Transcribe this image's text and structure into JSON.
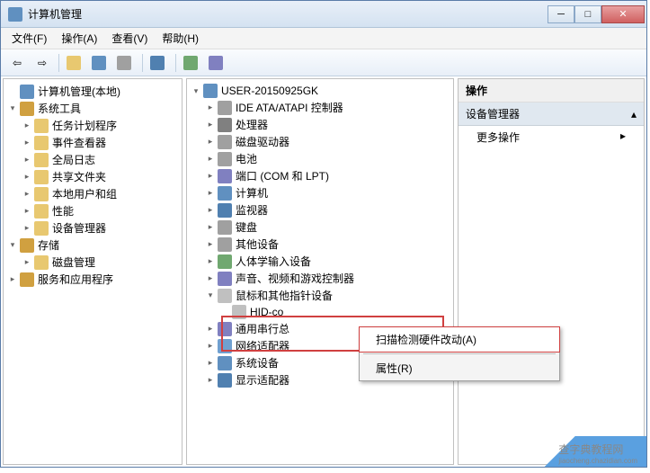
{
  "window": {
    "title": "计算机管理"
  },
  "menubar": [
    "文件(F)",
    "操作(A)",
    "查看(V)",
    "帮助(H)"
  ],
  "left_tree": {
    "root": "计算机管理(本地)",
    "groups": [
      {
        "label": "系统工具",
        "expanded": true,
        "children": [
          "任务计划程序",
          "事件查看器",
          "全局日志",
          "共享文件夹",
          "本地用户和组",
          "性能",
          "设备管理器"
        ]
      },
      {
        "label": "存储",
        "expanded": true,
        "children": [
          "磁盘管理"
        ]
      },
      {
        "label": "服务和应用程序",
        "expanded": false,
        "children": []
      }
    ]
  },
  "mid_tree": {
    "root": "USER-20150925GK",
    "items": [
      {
        "label": "IDE ATA/ATAPI 控制器",
        "ex": false
      },
      {
        "label": "处理器",
        "ex": false
      },
      {
        "label": "磁盘驱动器",
        "ex": false
      },
      {
        "label": "电池",
        "ex": false
      },
      {
        "label": "端口 (COM 和 LPT)",
        "ex": false
      },
      {
        "label": "计算机",
        "ex": false
      },
      {
        "label": "监视器",
        "ex": false
      },
      {
        "label": "键盘",
        "ex": false
      },
      {
        "label": "其他设备",
        "ex": false
      },
      {
        "label": "人体学输入设备",
        "ex": false
      },
      {
        "label": "声音、视频和游戏控制器",
        "ex": false
      },
      {
        "label": "鼠标和其他指针设备",
        "ex": true,
        "children": [
          "HID-co"
        ]
      },
      {
        "label": "通用串行总",
        "ex": false
      },
      {
        "label": "网络适配器",
        "ex": false
      },
      {
        "label": "系统设备",
        "ex": false
      },
      {
        "label": "显示适配器",
        "ex": false
      }
    ]
  },
  "actions": {
    "header": "操作",
    "sub": "设备管理器",
    "more": "更多操作"
  },
  "context_menu": {
    "scan": "扫描检测硬件改动(A)",
    "props": "属性(R)"
  },
  "watermark": {
    "line1": "查字典教程网",
    "line2": "jiaocheng.chazidian.com"
  }
}
